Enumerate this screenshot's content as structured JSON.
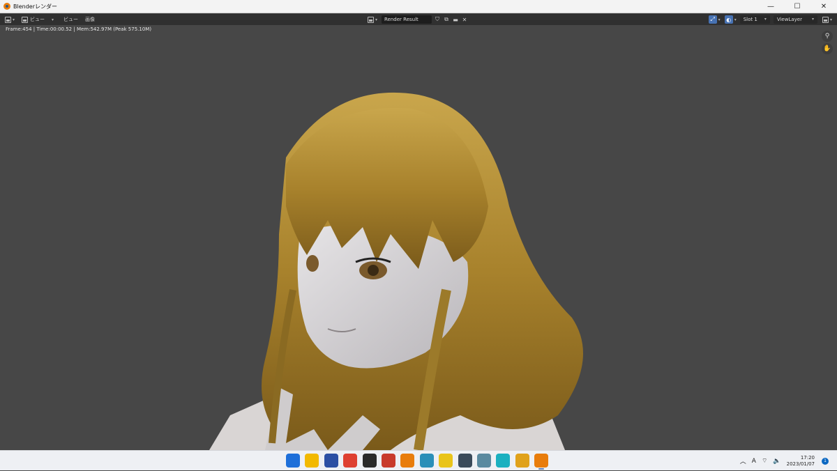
{
  "window": {
    "title": "Blenderレンダー",
    "controls": {
      "minimize": "—",
      "maximize": "☐",
      "close": "✕"
    }
  },
  "header": {
    "view_menu": "ビュー",
    "view_menu2": "ビュー",
    "image_menu": "画像",
    "render_result": "Render Result",
    "slot": "Slot 1",
    "view_layer": "ViewLayer"
  },
  "stats": "Frame:454 | Time:00:00.52 | Mem:542.97M (Peak 575.10M)",
  "taskbar": {
    "apps": [
      {
        "name": "windows-start-icon",
        "color": "#1e6fd9"
      },
      {
        "name": "file-explorer-icon",
        "color": "#f2b900"
      },
      {
        "name": "app-blue-icon",
        "color": "#2b4fa3"
      },
      {
        "name": "chrome-icon",
        "color": "#de4032"
      },
      {
        "name": "epic-games-icon",
        "color": "#2a2a2a"
      },
      {
        "name": "app-red-icon",
        "color": "#c83a2b"
      },
      {
        "name": "blender-icon",
        "color": "#e87d0d"
      },
      {
        "name": "app-teal-icon",
        "color": "#2b8fb8"
      },
      {
        "name": "app-yellow-icon",
        "color": "#e9c41a"
      },
      {
        "name": "app-dark-icon",
        "color": "#3a4a5a"
      },
      {
        "name": "app-character-icon",
        "color": "#5a8aa0"
      },
      {
        "name": "app-cyan-icon",
        "color": "#1ab0c0"
      },
      {
        "name": "chrome-canary-icon",
        "color": "#e0a21c"
      },
      {
        "name": "blender-active-icon",
        "color": "#e87d0d"
      }
    ],
    "time": "17:20",
    "date": "2023/01/07",
    "notifications": "1",
    "ime": "A"
  }
}
